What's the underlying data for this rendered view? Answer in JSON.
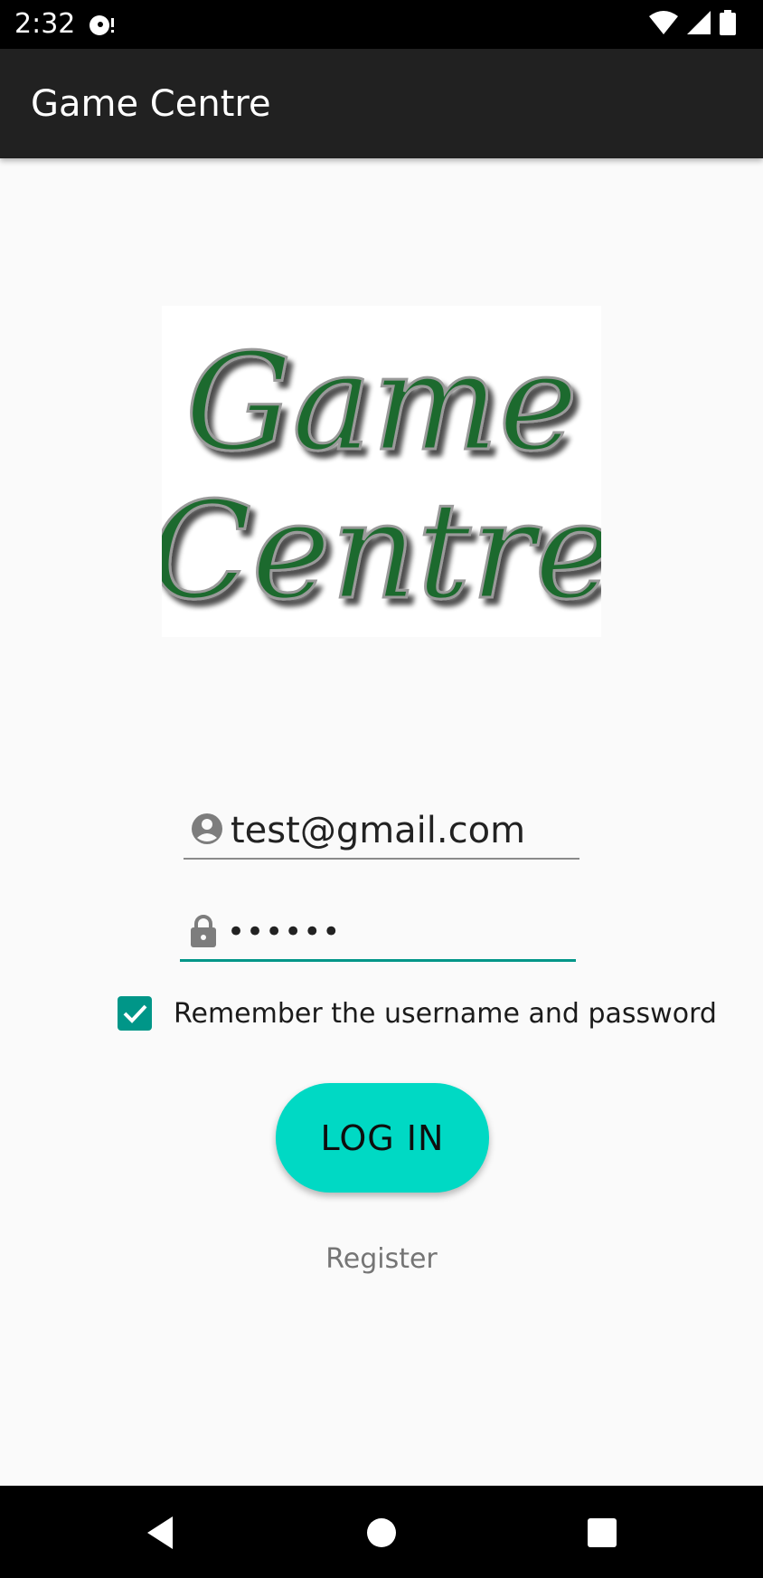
{
  "status_bar": {
    "time": "2:32",
    "icons": [
      "media-notification-icon",
      "wifi-icon",
      "cell-signal-icon",
      "battery-icon"
    ]
  },
  "app_bar": {
    "title": "Game Centre"
  },
  "logo": {
    "line1": "Game",
    "line2": "Centre",
    "color": "#1e6b2e"
  },
  "login_form": {
    "email_value": "test@gmail.com",
    "password_mask": "••••••",
    "remember_checked": true,
    "remember_label": "Remember the username and password",
    "login_button_label": "LOG IN",
    "register_link_label": "Register"
  },
  "colors": {
    "accent": "#009688",
    "button": "#00d9c4",
    "app_bar": "#212121"
  },
  "nav_bar": {
    "buttons": [
      "back-icon",
      "home-icon",
      "recents-icon"
    ]
  }
}
